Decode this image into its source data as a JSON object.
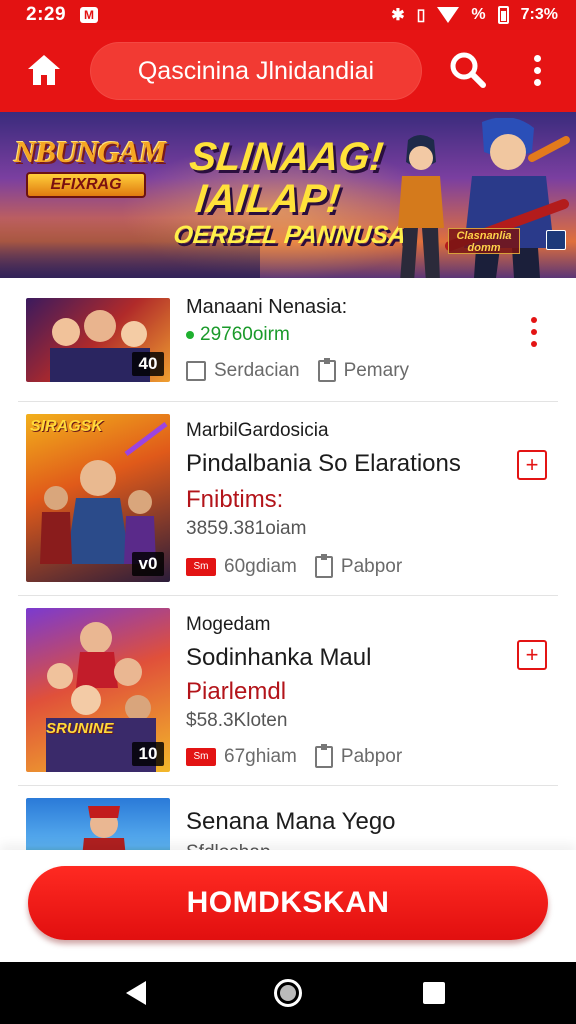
{
  "status_bar": {
    "time": "2:29",
    "sim_badge": "M",
    "battery_text": "7:3%",
    "percent_glyph": "%"
  },
  "app_bar": {
    "search_text": "Qascinina Jlnidandiai",
    "icons": [
      "home-icon",
      "search-icon",
      "more-vert-icon"
    ]
  },
  "banner": {
    "logo_line1": "NBUNGAM",
    "logo_line2": "EFIXRAG",
    "headline1": "SLINAAG!",
    "headline2": "IAILAP!",
    "headline3": "OERBEL PANNUSA!",
    "corner_tag": "Clasnanlia domm"
  },
  "items": [
    {
      "title": "Manaani Nenasia:",
      "status": "29760oirm",
      "thumb_badge": "40",
      "meta1": "Serdacian",
      "meta2": "Pemary",
      "action": "kebab"
    },
    {
      "label": "MarbilGardosicia",
      "title": "Pindalbania So Elarations",
      "subtitle": "Fnibtims:",
      "price": "3859.381oiam",
      "thumb_badge": "v0",
      "thumb_tag": "SIRAGSK",
      "chip": "Sm",
      "meta1": "60gdiam",
      "meta2": "Pabpor",
      "action": "add"
    },
    {
      "label": "Mogedam",
      "title": "Sodinhanka Maul",
      "subtitle": "Piarlemdl",
      "price": "$58.3Kloten",
      "thumb_badge": "10",
      "thumb_tag": "SRUNINE",
      "chip": "Sm",
      "meta1": "67ghiam",
      "meta2": "Pabpor",
      "action": "add"
    },
    {
      "title": "Senana Mana Yego",
      "price": "Sfdloshap",
      "action": "add"
    }
  ],
  "cta": {
    "label": "HOMDKSKAN"
  },
  "colors": {
    "brand_red": "#e61414",
    "accent_green": "#1a9a2a",
    "subtitle_red": "#b3141a"
  }
}
